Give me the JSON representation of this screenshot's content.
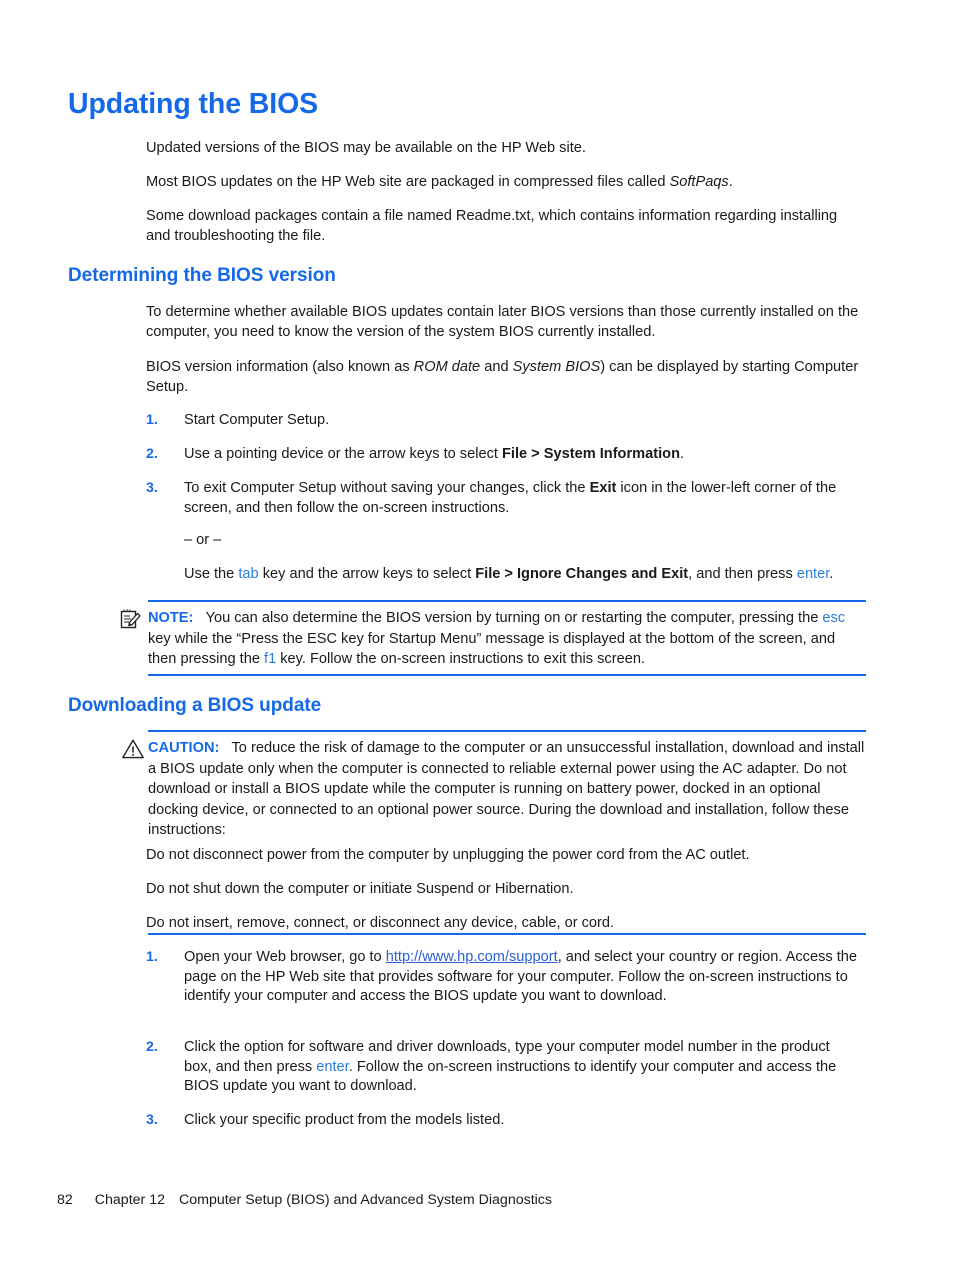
{
  "document": {
    "title": "Updating the BIOS",
    "intro_paragraphs": [
      "Updated versions of the BIOS may be available on the HP Web site.",
      "Most BIOS updates on the HP Web site are packaged in compressed files called SoftPaqs.",
      "Some download packages contain a file named Readme.txt, which contains information regarding installing and troubleshooting the file."
    ],
    "softpaqs_term": "SoftPaqs",
    "section_determining": {
      "heading": "Determining the BIOS version",
      "paragraph_1": "To determine whether available BIOS updates contain later BIOS versions than those currently installed on the computer, you need to know the version of the system BIOS currently installed.",
      "paragraph_2_pre": "BIOS version information (also known as ",
      "paragraph_2_italic_1": "ROM date",
      "paragraph_2_mid": " and ",
      "paragraph_2_italic_2": "System BIOS",
      "paragraph_2_post": ") can be displayed by starting Computer Setup.",
      "steps": [
        {
          "number": "1.",
          "text": "Start Computer Setup."
        },
        {
          "number": "2.",
          "pre": "Use a pointing device or the arrow keys to select ",
          "bold": "File > System Information",
          "post": "."
        },
        {
          "number": "3.",
          "pre": "To exit Computer Setup without saving your changes, click the ",
          "bold": "Exit",
          "post": " icon in the lower-left corner of the screen, and then follow the on-screen instructions.",
          "or_divider": "– or –",
          "alt_pre": "Use the ",
          "alt_key_1": "tab",
          "alt_mid": " key and the arrow keys to select ",
          "alt_bold": "File > Ignore Changes and Exit",
          "alt_post": ", and then press ",
          "alt_key_2": "enter",
          "alt_end": "."
        }
      ]
    },
    "note": {
      "icon": "note-pencil-icon",
      "label": "NOTE:",
      "text_part_1": "You can also determine the BIOS version by turning on or restarting the computer, pressing the ",
      "key_1": "esc",
      "text_part_2": " key while the “Press the ESC key for Startup Menu” message is displayed at the bottom of the screen, and then pressing the ",
      "key_2": "f1",
      "text_part_3": " key. Follow the on-screen instructions to exit this screen."
    },
    "section_downloading": {
      "heading": "Downloading a BIOS update",
      "caution": {
        "icon": "warning-triangle-icon",
        "label": "CAUTION:",
        "text": "To reduce the risk of damage to the computer or an unsuccessful installation, download and install a BIOS update only when the computer is connected to reliable external power using the AC adapter. Do not download or install a BIOS update while the computer is running on battery power, docked in an optional docking device, or connected to an optional power source. During the download and installation, follow these instructions:",
        "bullets": [
          "Do not disconnect power from the computer by unplugging the power cord from the AC outlet.",
          "Do not shut down the computer or initiate Suspend or Hibernation.",
          "Do not insert, remove, connect, or disconnect any device, cable, or cord."
        ]
      },
      "steps": [
        {
          "number": "1.",
          "pre": "Open your Web browser, go to ",
          "link": "http://www.hp.com/support",
          "post": ", and select your country or region. Access the page on the HP Web site that provides software for your computer. Follow the on-screen instructions to identify your computer and access the BIOS update you want to download."
        },
        {
          "number": "2.",
          "pre": "Click the option for software and driver downloads, type your computer model number in the product box, and then press ",
          "key": "enter",
          "post": ". Follow the on-screen instructions to identify your computer and access the BIOS update you want to download."
        },
        {
          "number": "3.",
          "text": "Click your specific product from the models listed."
        }
      ]
    },
    "footer": {
      "page_number": "82",
      "chapter": "Chapter 12",
      "chapter_title": "Computer Setup (BIOS) and Advanced System Diagnostics"
    },
    "colors": {
      "heading_blue": "#1569e8",
      "key_blue": "#2a7de1",
      "link_blue": "#2a5fd4",
      "body_text": "#1a1a1a",
      "page_background": "#ffffff"
    }
  }
}
